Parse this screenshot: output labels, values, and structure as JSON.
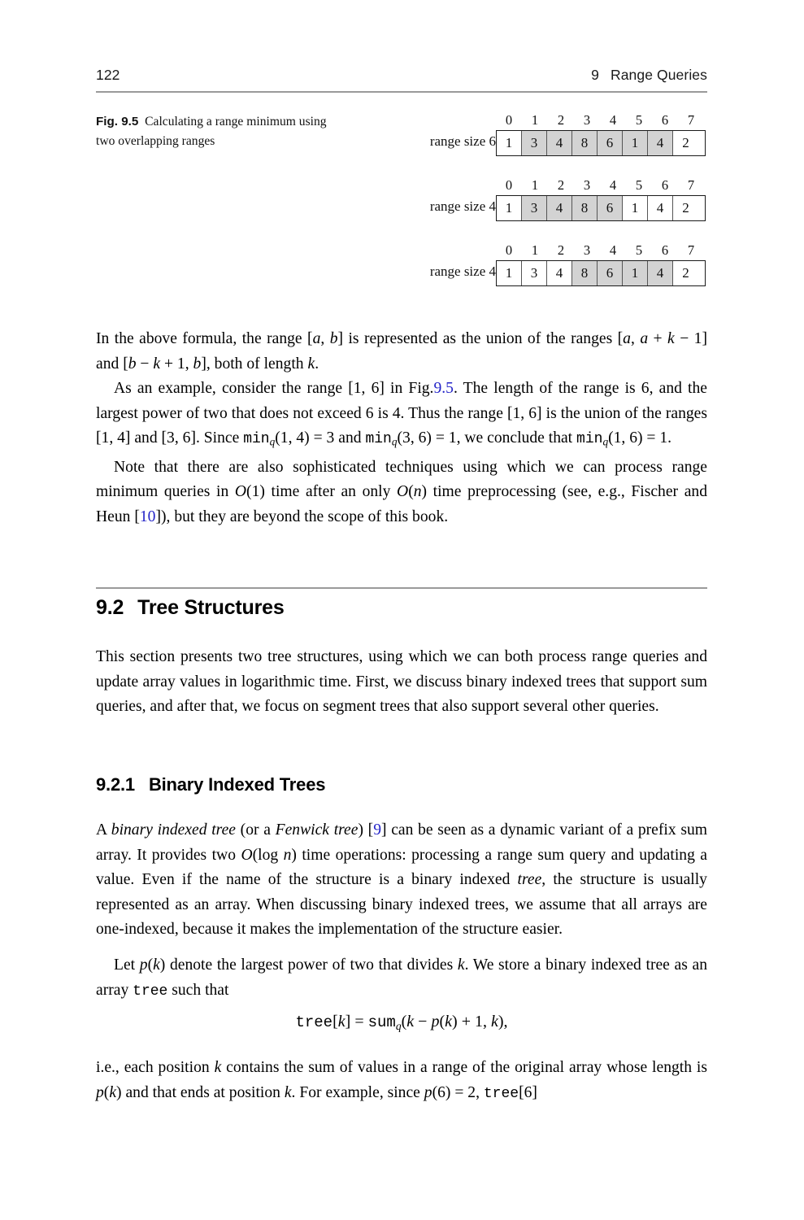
{
  "page": {
    "number": "122",
    "chapter_number": "9",
    "chapter_title": "Range Queries"
  },
  "figure": {
    "label": "Fig. 9.5",
    "caption": "Calculating a range minimum using two overlapping ranges",
    "indices": [
      "0",
      "1",
      "2",
      "3",
      "4",
      "5",
      "6",
      "7"
    ],
    "rows": [
      {
        "label": "range size 6",
        "values": [
          "1",
          "3",
          "4",
          "8",
          "6",
          "1",
          "4",
          "2"
        ],
        "shaded": [
          false,
          true,
          true,
          true,
          true,
          true,
          true,
          false
        ]
      },
      {
        "label": "range size 4",
        "values": [
          "1",
          "3",
          "4",
          "8",
          "6",
          "1",
          "4",
          "2"
        ],
        "shaded": [
          false,
          true,
          true,
          true,
          true,
          false,
          false,
          false
        ]
      },
      {
        "label": "range size 4",
        "values": [
          "1",
          "3",
          "4",
          "8",
          "6",
          "1",
          "4",
          "2"
        ],
        "shaded": [
          false,
          false,
          false,
          true,
          true,
          true,
          true,
          false
        ]
      }
    ],
    "shade_color": "#d3d3d3"
  },
  "text": {
    "p1_part1": "In the above formula, the range [",
    "p1_a": "a",
    "p1_comma1": ", ",
    "p1_b": "b",
    "p1_part2": "] is represented as the union of the ranges [",
    "p1_a2": "a",
    "p1_part3": ", ",
    "p1_a3": "a",
    "p1_plus": " + ",
    "p1_k1": "k",
    "p1_minus1": " − 1] and [",
    "p1_b2": "b",
    "p1_minus2": " − ",
    "p1_k2": "k",
    "p1_plus2": " + 1, ",
    "p1_b3": "b",
    "p1_end": "], both of length ",
    "p1_k3": "k",
    "p1_period": ".",
    "p2_s1": "As an example, consider the range [1, 6] in Fig.",
    "p2_figref": "9.5",
    "p2_s2": ". The length of the range is 6, and the largest power of two that does not exceed 6 is 4. Thus the range [1, 6] is the union of the ranges [1, 4] and [3, 6]. Since ",
    "p2_min1": "min",
    "p2_sub1": "q",
    "p2_s3": "(1, 4) = 3 and ",
    "p2_min2": "min",
    "p2_sub2": "q",
    "p2_s4": "(3, 6) = 1, we conclude that ",
    "p2_min3": "min",
    "p2_sub3": "q",
    "p2_s5": "(1, 6) = 1.",
    "p3_s1": "Note that there are also sophisticated techniques using which we can process range minimum queries in ",
    "p3_O1": "O",
    "p3_s2": "(1) time after an only ",
    "p3_O2": "O",
    "p3_paren_n": "(",
    "p3_n": "n",
    "p3_s3": ") time preprocessing (see, e.g., Fischer and Heun [",
    "p3_ref": "10",
    "p3_s4": "]), but they are beyond the scope of this book.",
    "p4": "This section presents two tree structures, using which we can both process range queries and update array values in logarithmic time. First, we discuss binary indexed trees that support sum queries, and after that, we focus on segment trees that also support several other queries.",
    "p5_s1": "A ",
    "p5_it1": "binary indexed tree",
    "p5_s2": " (or a ",
    "p5_it2": "Fenwick tree",
    "p5_s3": ") [",
    "p5_ref": "9",
    "p5_s4": "] can be seen as a dynamic variant of a prefix sum array. It provides two ",
    "p5_O": "O",
    "p5_log": "(log ",
    "p5_n": "n",
    "p5_s5": ") time operations: processing a range sum query and updating a value. Even if the name of the structure is a binary indexed ",
    "p5_it3": "tree",
    "p5_s6": ", the structure is usually represented as an array. When discussing binary indexed trees, we assume that all arrays are one-indexed, because it makes the implementation of the structure easier.",
    "p6_s1": "Let ",
    "p6_p": "p",
    "p6_s2": "(",
    "p6_k1": "k",
    "p6_s3": ") denote the largest power of two that divides ",
    "p6_k2": "k",
    "p6_s4": ". We store a binary indexed tree as an array ",
    "p6_mono": "tree",
    "p6_s5": " such that",
    "p7_s1": "i.e., each position ",
    "p7_k1": "k",
    "p7_s2": " contains the sum of values in a range of the original array whose length is ",
    "p7_p": "p",
    "p7_s3": "(",
    "p7_k2": "k",
    "p7_s4": ") and that ends at position ",
    "p7_k3": "k",
    "p7_s5": ". For example, since ",
    "p7_p2": "p",
    "p7_s6": "(6) = 2, ",
    "p7_mono": "tree",
    "p7_s7": "[6]"
  },
  "equation": {
    "lhs_mono": "tree",
    "lhs_bracket_open": "[",
    "lhs_k": "k",
    "lhs_bracket_close": "]",
    "eq": " = ",
    "rhs_mono": "sum",
    "rhs_sub": "q",
    "rhs_open": "(",
    "rhs_k1": "k",
    "rhs_minus": " − ",
    "rhs_p": "p",
    "rhs_pk_open": "(",
    "rhs_k2": "k",
    "rhs_pk_close": ")",
    "rhs_plus": " + 1, ",
    "rhs_k3": "k",
    "rhs_close": "),"
  },
  "headings": {
    "section_number": "9.2",
    "section_title": "Tree Structures",
    "subsection_number": "9.2.1",
    "subsection_title": "Binary Indexed Trees"
  },
  "colors": {
    "link": "#2424c8",
    "rule": "#9a9a9a",
    "cell_shade": "#d3d3d3",
    "text": "#000000"
  }
}
